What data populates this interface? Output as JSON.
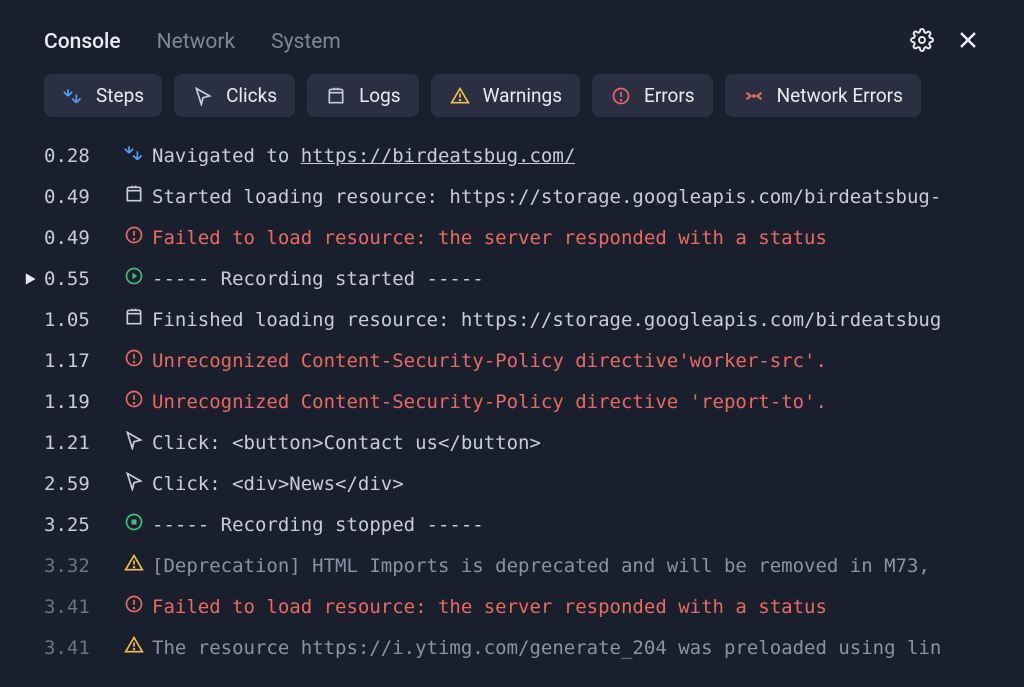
{
  "tabs": {
    "console": "Console",
    "network": "Network",
    "system": "System"
  },
  "filters": {
    "steps": "Steps",
    "clicks": "Clicks",
    "logs": "Logs",
    "warnings": "Warnings",
    "errors": "Errors",
    "network_errors": "Network Errors"
  },
  "log": [
    {
      "time": "0.28",
      "marker": false,
      "bright": true,
      "icon": "steps",
      "type": "navigate",
      "prefix": "Navigated to ",
      "link": "https://birdeatsbug.com/"
    },
    {
      "time": "0.49",
      "marker": false,
      "bright": true,
      "icon": "log",
      "type": "text",
      "text": "Started loading resource: https://storage.googleapis.com/birdeatsbug-"
    },
    {
      "time": "0.49",
      "marker": false,
      "bright": true,
      "icon": "error",
      "type": "error",
      "text": "Failed to load resource: the server responded with a status"
    },
    {
      "time": "0.55",
      "marker": true,
      "bright": true,
      "icon": "recstart",
      "type": "text",
      "text": "----- Recording started -----"
    },
    {
      "time": "1.05",
      "marker": false,
      "bright": true,
      "icon": "log",
      "type": "text",
      "text": "Finished loading resource: https://storage.googleapis.com/birdeatsbug"
    },
    {
      "time": "1.17",
      "marker": false,
      "bright": true,
      "icon": "error",
      "type": "error",
      "text": "Unrecognized Content-Security-Policy directive'worker-src'."
    },
    {
      "time": "1.19",
      "marker": false,
      "bright": true,
      "icon": "error",
      "type": "error",
      "text": "Unrecognized Content-Security-Policy directive 'report-to'."
    },
    {
      "time": "1.21",
      "marker": false,
      "bright": true,
      "icon": "cursor",
      "type": "text",
      "text": "Click: <button>Contact us</button>"
    },
    {
      "time": "2.59",
      "marker": false,
      "bright": true,
      "icon": "cursor",
      "type": "text",
      "text": "Click: <div>News</div>"
    },
    {
      "time": "3.25",
      "marker": false,
      "bright": true,
      "icon": "recstop",
      "type": "text",
      "text": "----- Recording stopped -----"
    },
    {
      "time": "3.32",
      "marker": false,
      "bright": false,
      "icon": "warn",
      "type": "muted",
      "text": "[Deprecation] HTML Imports is deprecated and will be removed in M73,"
    },
    {
      "time": "3.41",
      "marker": false,
      "bright": false,
      "icon": "error",
      "type": "error",
      "text": "Failed to load resource: the server responded with a status"
    },
    {
      "time": "3.41",
      "marker": false,
      "bright": false,
      "icon": "warn",
      "type": "muted",
      "text": "The resource https://i.ytimg.com/generate_204 was preloaded using lin"
    }
  ]
}
